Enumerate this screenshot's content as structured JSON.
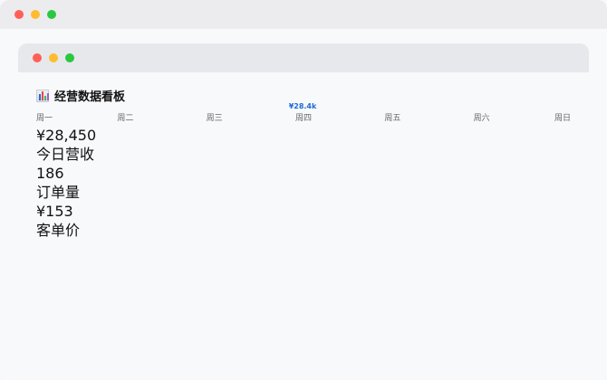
{
  "window": {
    "outer_dots": [
      "red",
      "yellow",
      "green"
    ],
    "inner_dots": [
      "red",
      "yellow",
      "green"
    ]
  },
  "page": {
    "title": "经营数据看板",
    "title_icon": "bar-chart-icon"
  },
  "chart_data": {
    "type": "bar",
    "categories": [
      "周一",
      "周二",
      "周三",
      "周四",
      "周五",
      "周六",
      "周日"
    ],
    "values_label": "¥28.4k"
  },
  "kpis": [
    {
      "value": "¥28,450",
      "label": "今日营收"
    },
    {
      "value": "186",
      "label": "订单量"
    },
    {
      "value": "¥153",
      "label": "客单价"
    }
  ],
  "colors": {
    "accent": "#1f6bd6",
    "close": "#ff5f57",
    "minimize": "#febc2e",
    "maximize": "#28c840"
  }
}
